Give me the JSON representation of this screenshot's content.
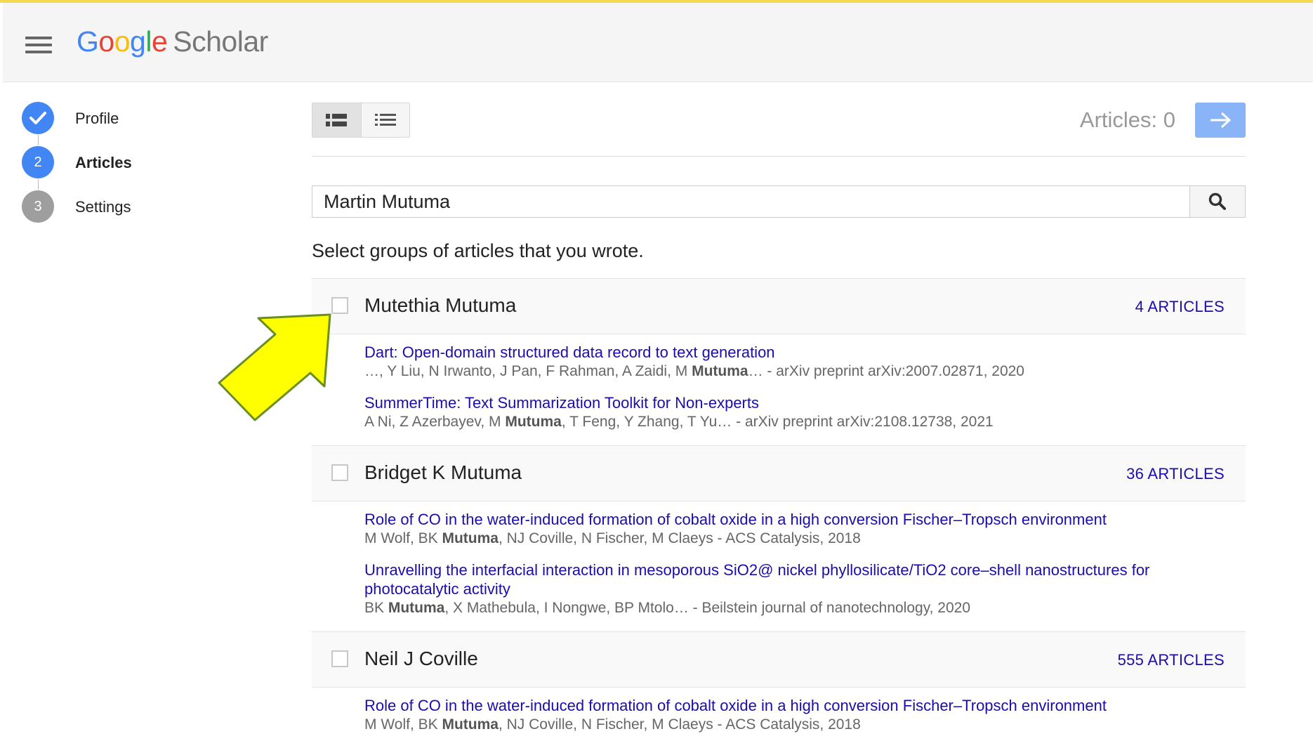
{
  "header": {
    "logo_google": [
      "G",
      "o",
      "o",
      "g",
      "l",
      "e"
    ],
    "logo_scholar": "Scholar"
  },
  "steps": [
    {
      "label": "Profile",
      "state": "done"
    },
    {
      "label": "Articles",
      "number": "2",
      "state": "active"
    },
    {
      "label": "Settings",
      "number": "3",
      "state": "todo"
    }
  ],
  "toolbar": {
    "articles_count": "Articles: 0"
  },
  "search": {
    "value": "Martin Mutuma"
  },
  "instruction": "Select groups of articles that you wrote.",
  "groups": [
    {
      "name": "Mutethia Mutuma",
      "count": "4 ARTICLES",
      "articles": [
        {
          "title": "Dart: Open-domain structured data record to text generation",
          "authors_pre": "…, Y Liu, N Irwanto, J Pan, F Rahman, A Zaidi, M ",
          "authors_bold": "Mutuma",
          "authors_post": "… - arXiv preprint arXiv:2007.02871, 2020"
        },
        {
          "title": "SummerTime: Text Summarization Toolkit for Non-experts",
          "authors_pre": "A Ni, Z Azerbayev, M ",
          "authors_bold": "Mutuma",
          "authors_post": ", T Feng, Y Zhang, T Yu… - arXiv preprint arXiv:2108.12738, 2021"
        }
      ]
    },
    {
      "name": "Bridget K Mutuma",
      "count": "36 ARTICLES",
      "articles": [
        {
          "title": "Role of CO in the water-induced formation of cobalt oxide in a high conversion Fischer–Tropsch environment",
          "authors_pre": "M Wolf, BK ",
          "authors_bold": "Mutuma",
          "authors_post": ", NJ Coville, N Fischer, M Claeys - ACS Catalysis, 2018"
        },
        {
          "title": "Unravelling the interfacial interaction in mesoporous SiO2@ nickel phyllosilicate/TiO2 core–shell nanostructures for photocatalytic activity",
          "authors_pre": "BK ",
          "authors_bold": "Mutuma",
          "authors_post": ", X Mathebula, I Nongwe, BP Mtolo… - Beilstein journal of nanotechnology, 2020"
        }
      ]
    },
    {
      "name": "Neil J Coville",
      "count": "555 ARTICLES",
      "articles": [
        {
          "title": "Role of CO in the water-induced formation of cobalt oxide in a high conversion Fischer–Tropsch environment",
          "authors_pre": "M Wolf, BK ",
          "authors_bold": "Mutuma",
          "authors_post": ", NJ Coville, N Fischer, M Claeys - ACS Catalysis, 2018"
        }
      ]
    }
  ],
  "colors": {
    "accent": "#4285f4",
    "link": "#1a0dab",
    "next_button": "#8ab4f8",
    "arrow_fill": "#ffff00",
    "arrow_stroke": "#6b8e23"
  },
  "icons": {
    "menu": "hamburger-menu-icon",
    "check": "check-icon",
    "detailed_view": "detailed-list-icon",
    "compact_view": "compact-list-icon",
    "next": "arrow-right-icon",
    "search": "search-icon",
    "annotation": "yellow-pointer-arrow"
  }
}
